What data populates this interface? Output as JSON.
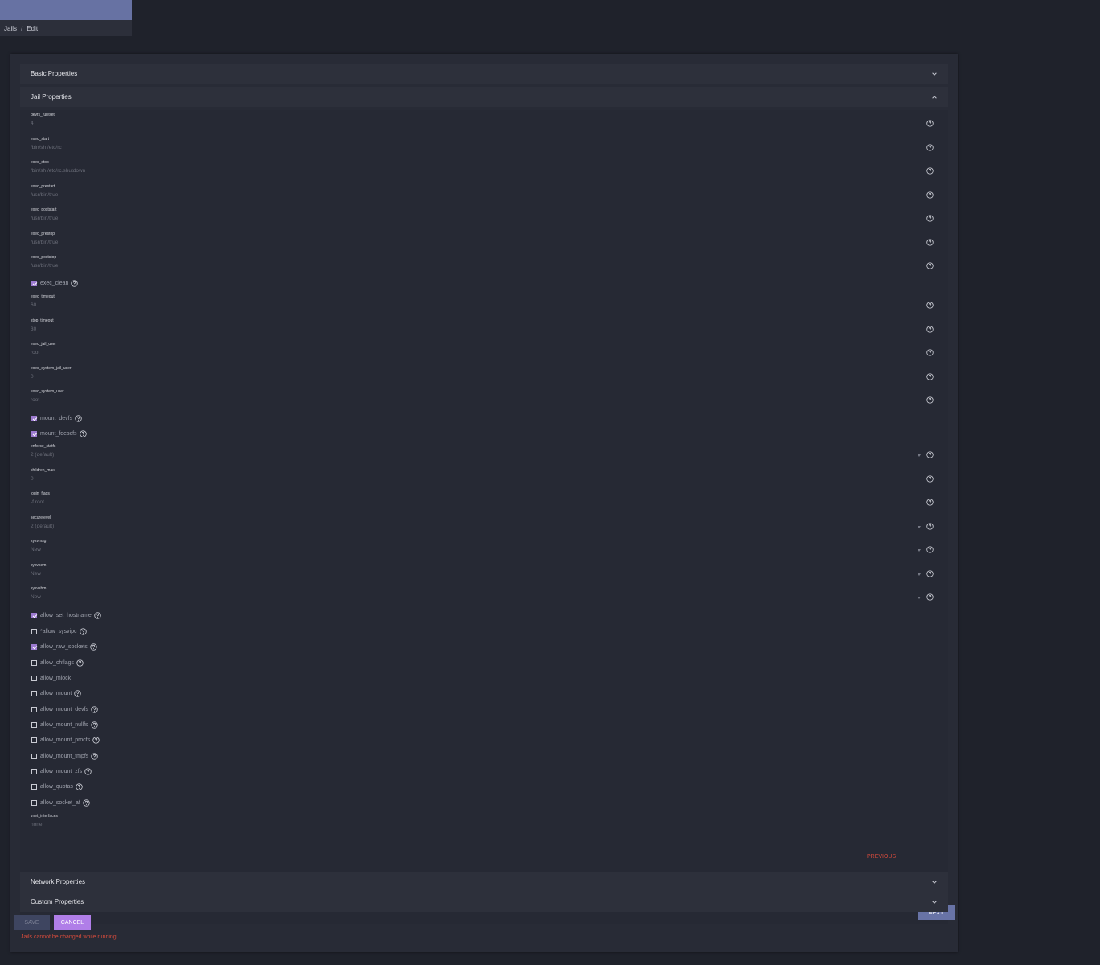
{
  "breadcrumb": {
    "jails": "Jails",
    "separator": "/",
    "edit": "Edit"
  },
  "panels": {
    "basic": "Basic Properties",
    "jail": "Jail Properties",
    "network": "Network Properties",
    "custom": "Custom Properties"
  },
  "fields": [
    {
      "label": "devfs_ruleset",
      "value": "4"
    },
    {
      "label": "exec_start",
      "value": "/bin/sh /etc/rc"
    },
    {
      "label": "exec_stop",
      "value": "/bin/sh /etc/rc.shutdown"
    },
    {
      "label": "exec_prestart",
      "value": "/usr/bin/true"
    },
    {
      "label": "exec_poststart",
      "value": "/usr/bin/true"
    },
    {
      "label": "exec_prestop",
      "value": "/usr/bin/true"
    },
    {
      "label": "exec_poststop",
      "value": "/usr/bin/true"
    },
    {
      "label": "exec_timeout",
      "value": "60"
    },
    {
      "label": "stop_timeout",
      "value": "30"
    },
    {
      "label": "exec_jail_user",
      "value": "root"
    },
    {
      "label": "exec_system_jail_user",
      "value": "0"
    },
    {
      "label": "exec_system_user",
      "value": "root"
    },
    {
      "label": "enforce_statfs",
      "value": "2 (default)"
    },
    {
      "label": "children_max",
      "value": "0"
    },
    {
      "label": "login_flags",
      "value": "-f root"
    },
    {
      "label": "securelevel",
      "value": "2 (default)"
    },
    {
      "label": "sysvmsg",
      "value": "New"
    },
    {
      "label": "sysvsem",
      "value": "New"
    },
    {
      "label": "sysvshm",
      "value": "New"
    },
    {
      "label": "vnet_interfaces",
      "value": "none"
    }
  ],
  "checkboxes": [
    {
      "label": "exec_clean",
      "checked": true
    },
    {
      "label": "mount_devfs",
      "checked": true
    },
    {
      "label": "mount_fdescfs",
      "checked": true
    },
    {
      "label": "allow_set_hostname",
      "checked": true
    },
    {
      "label": "*allow_sysvipc",
      "checked": false
    },
    {
      "label": "allow_raw_sockets",
      "checked": true
    },
    {
      "label": "allow_chflags",
      "checked": false
    },
    {
      "label": "allow_mlock",
      "checked": false
    },
    {
      "label": "allow_mount",
      "checked": false
    },
    {
      "label": "allow_mount_devfs",
      "checked": false
    },
    {
      "label": "allow_mount_nullfs",
      "checked": false
    },
    {
      "label": "allow_mount_procfs",
      "checked": false
    },
    {
      "label": "allow_mount_tmpfs",
      "checked": false
    },
    {
      "label": "allow_mount_zfs",
      "checked": false
    },
    {
      "label": "allow_quotas",
      "checked": false
    },
    {
      "label": "allow_socket_af",
      "checked": false
    }
  ],
  "buttons": {
    "previous": "PREVIOUS",
    "next": "NEXT",
    "save": "SAVE",
    "cancel": "CANCEL"
  },
  "error": "Jails cannot be changed while running.",
  "icons": {
    "help": "help-circle-icon",
    "expand": "chevron-down-icon",
    "collapse": "chevron-up-icon"
  }
}
